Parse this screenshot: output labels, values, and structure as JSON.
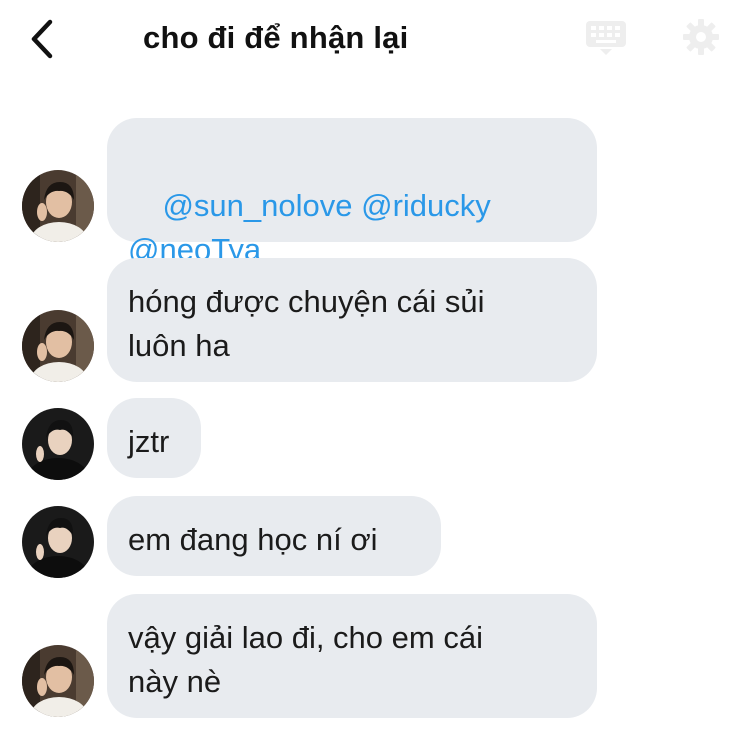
{
  "header": {
    "title": "cho đi để nhận lại",
    "back_icon": "chevron-left-icon",
    "keyboard_icon": "keyboard-icon",
    "settings_icon": "gear-icon"
  },
  "colors": {
    "bubble_bg": "#e8ebef",
    "mention": "#2a98e8",
    "text": "#1b1b1b",
    "faded_icon": "#eeeeee"
  },
  "messages": [
    {
      "sender_avatar": "avatar-light-shirt",
      "line1_mentions": [
        "@sun_nolove",
        "@riducky"
      ],
      "line2_mentions": [
        "@neoTya"
      ]
    },
    {
      "sender_avatar": "avatar-light-shirt",
      "text": "hóng được chuyện cái sủi\nluôn ha"
    },
    {
      "sender_avatar": "avatar-dark-jacket",
      "text": "jztr"
    },
    {
      "sender_avatar": "avatar-dark-jacket",
      "text": "em đang học ní ơi"
    },
    {
      "sender_avatar": "avatar-light-shirt",
      "text": "vậy giải lao đi, cho em cái\nnày nè"
    }
  ]
}
